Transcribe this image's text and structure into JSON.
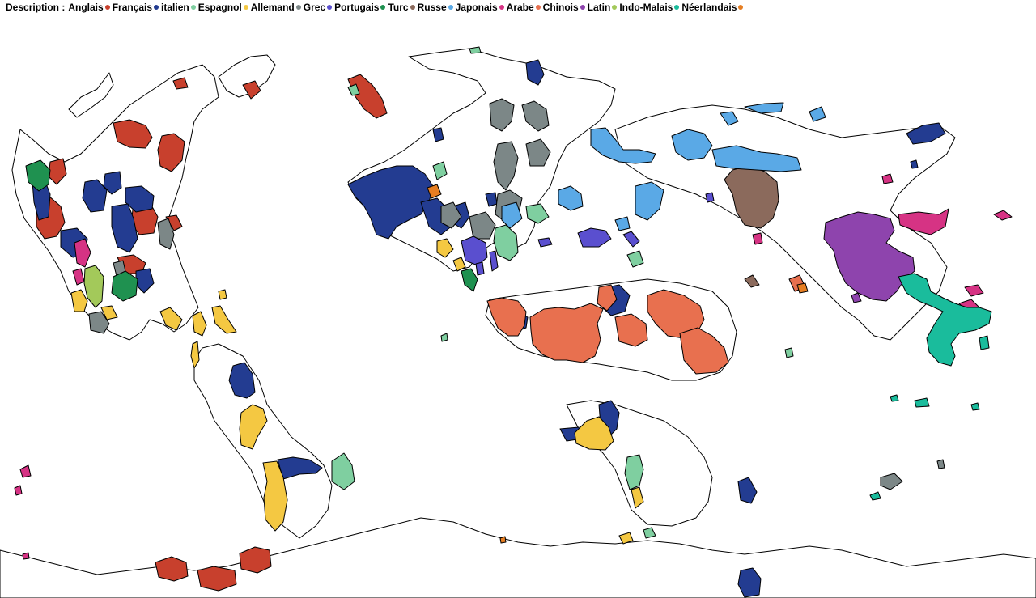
{
  "legend": {
    "title": "Description :",
    "items": [
      {
        "label": "Anglais",
        "color": "#c8402d"
      },
      {
        "label": "Français",
        "color": "#233c91"
      },
      {
        "label": "italien",
        "color": "#7fcfa0"
      },
      {
        "label": "Espagnol",
        "color": "#f4c842"
      },
      {
        "label": "Allemand",
        "color": "#7c8787"
      },
      {
        "label": "Grec",
        "color": "#5a4fcf"
      },
      {
        "label": "Portugais",
        "color": "#1f9150"
      },
      {
        "label": "Turc",
        "color": "#8b6a5c"
      },
      {
        "label": "Russe",
        "color": "#5aa9e6"
      },
      {
        "label": "Japonais",
        "color": "#d63384"
      },
      {
        "label": "Arabe",
        "color": "#e8704f"
      },
      {
        "label": "Chinois",
        "color": "#8e44ad"
      },
      {
        "label": "Latin",
        "color": "#a3c95a"
      },
      {
        "label": "Indo-Malais",
        "color": "#1abc9c"
      },
      {
        "label": "Néerlandais",
        "color": "#e67e22"
      }
    ]
  }
}
